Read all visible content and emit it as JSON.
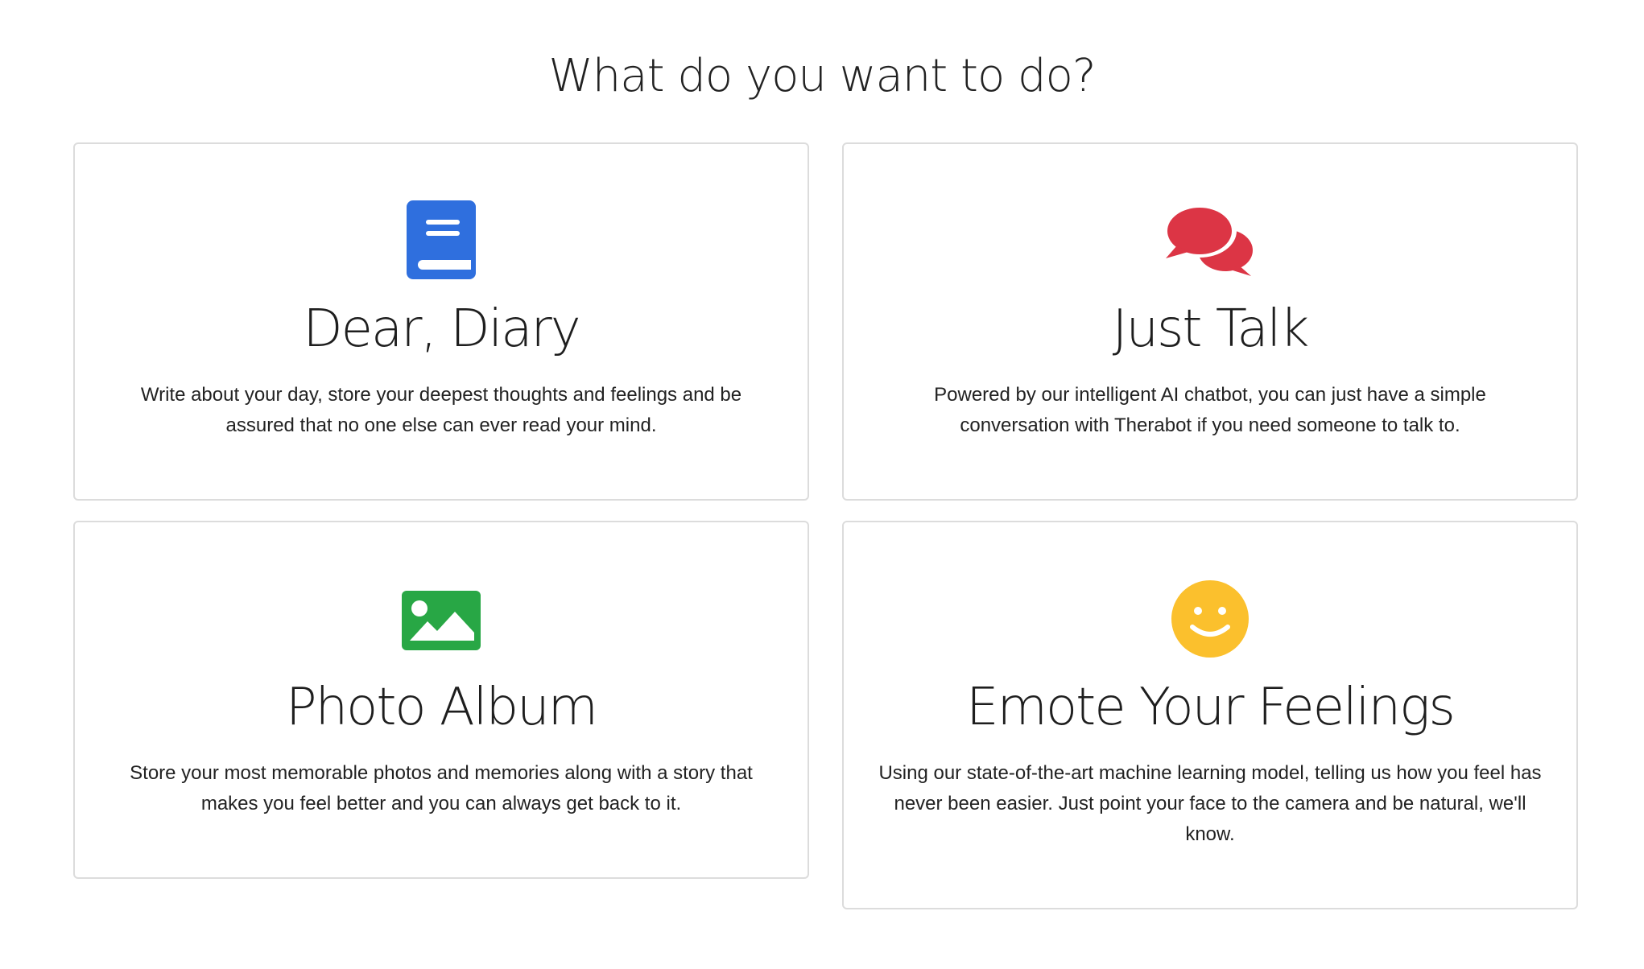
{
  "page": {
    "title": "What do you want to do?"
  },
  "cards": [
    {
      "id": "diary",
      "icon": "book-icon",
      "icon_color": "#2f6fde",
      "title": "Dear, Diary",
      "description": "Write about your day, store your deepest thoughts and feelings and be assured that no one else can ever read your mind."
    },
    {
      "id": "talk",
      "icon": "chat-bubbles-icon",
      "icon_color": "#dc3545",
      "title": "Just Talk",
      "description": "Powered by our intelligent AI chatbot, you can just have a simple conversation with Therabot if you need someone to talk to."
    },
    {
      "id": "photo",
      "icon": "image-icon",
      "icon_color": "#28a745",
      "title": "Photo Album",
      "description": "Store your most memorable photos and memories along with a story that makes you feel better and you can always get back to it."
    },
    {
      "id": "emote",
      "icon": "smiley-icon",
      "icon_color": "#fbc02d",
      "title": "Emote Your Feelings",
      "description": "Using our state-of-the-art machine learning model, telling us how you feel has never been easier. Just point your face to the camera and be natural, we'll know."
    }
  ]
}
